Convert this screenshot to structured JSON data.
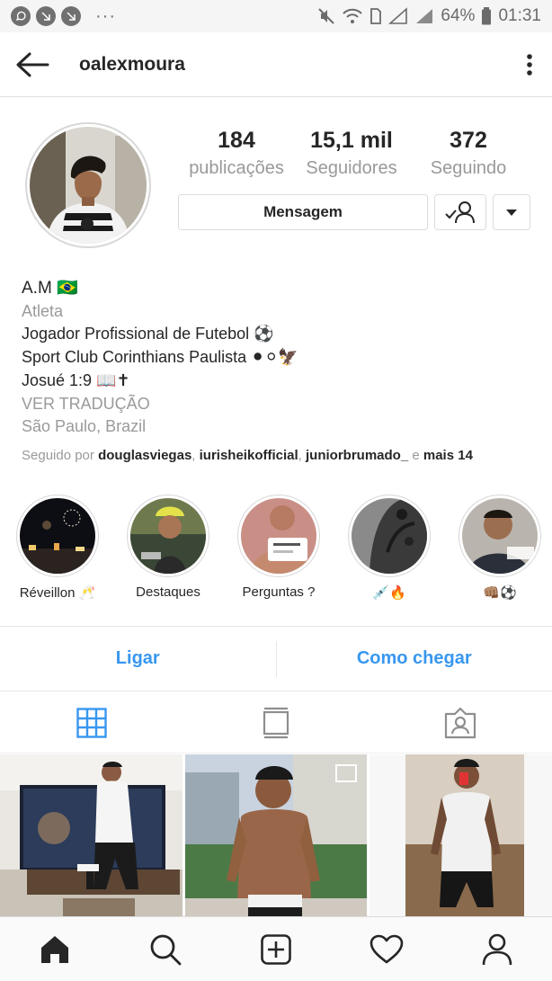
{
  "status_bar": {
    "battery": "64%",
    "time": "01:31",
    "left_icons": [
      "whatsapp-icon",
      "missed-call-icon",
      "missed-call-icon"
    ],
    "more": "···"
  },
  "header": {
    "username": "oalexmoura",
    "back_icon": "arrow-left-icon",
    "menu_icon": "more-vertical-icon"
  },
  "stats": [
    {
      "value": "184",
      "label": "publicações"
    },
    {
      "value": "15,1 mil",
      "label": "Seguidores"
    },
    {
      "value": "372",
      "label": "Seguindo"
    }
  ],
  "buttons": {
    "message": "Mensagem",
    "follow_icon": "user-check-icon",
    "dropdown_icon": "caret-down-icon"
  },
  "bio": {
    "name": "A.M 🇧🇷",
    "category": "Atleta",
    "line1": "Jogador Profissional de Futebol ⚽",
    "line2": "Sport Club Corinthians Paulista ⚫⚪🦅",
    "line3": "Josué 1:9 📖✝",
    "translate": "VER TRADUÇÃO",
    "location": "São Paulo, Brazil",
    "followed_prefix": "Seguido por ",
    "followed_user1": "douglasviegas",
    "followed_user2": "iurisheikofficial",
    "followed_user3": "juniorbrumado_",
    "followed_and": " e ",
    "followed_more": "mais 14"
  },
  "highlights": [
    {
      "label": "Réveillon 🥂"
    },
    {
      "label": "Destaques"
    },
    {
      "label": "Perguntas ?"
    },
    {
      "label": "💉🔥"
    },
    {
      "label": "👊🏽⚽"
    }
  ],
  "contact": {
    "call": "Ligar",
    "directions": "Como chegar"
  },
  "tabs": [
    "grid-icon",
    "feed-icon",
    "tagged-icon"
  ],
  "bottom_nav": [
    "home-icon",
    "search-icon",
    "add-post-icon",
    "heart-icon",
    "profile-icon"
  ],
  "colors": {
    "link_blue": "#3897f0",
    "text": "#262626",
    "secondary": "#999999"
  }
}
